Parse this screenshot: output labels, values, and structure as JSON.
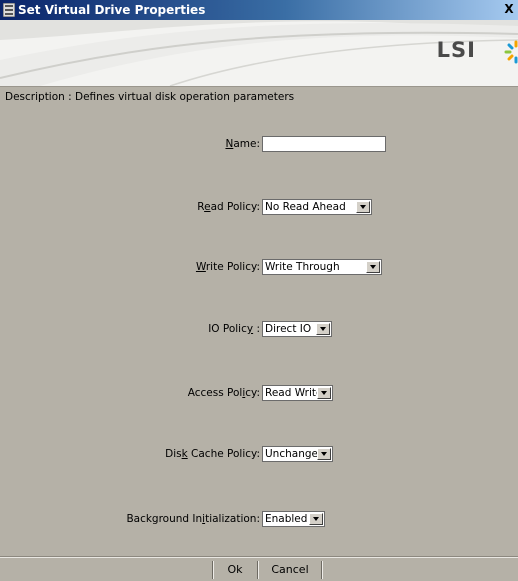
{
  "window": {
    "title": "Set Virtual Drive Properties",
    "close_glyph": "X"
  },
  "banner": {
    "logo_text": "LSI",
    "logo_icon": "lsi-starburst-icon"
  },
  "description": "Description : Defines virtual disk operation parameters",
  "form": {
    "name": {
      "label_pre": "",
      "label_ul": "N",
      "label_post": "ame:",
      "value": ""
    },
    "read_policy": {
      "label_pre": "R",
      "label_ul": "e",
      "label_post": "ad Policy:",
      "value": "No Read Ahead"
    },
    "write_policy": {
      "label_pre": "",
      "label_ul": "W",
      "label_post": "rite Policy:",
      "value": "Write Through"
    },
    "io_policy": {
      "label_pre": "IO Polic",
      "label_ul": "y",
      "label_post": " :",
      "value": "Direct IO"
    },
    "access_policy": {
      "label_pre": "Access Pol",
      "label_ul": "i",
      "label_post": "cy:",
      "value": "Read Write"
    },
    "disk_cache_policy": {
      "label_pre": "Dis",
      "label_ul": "k",
      "label_post": " Cache Policy:",
      "value": "Unchanged"
    },
    "background_init": {
      "label_pre": "Background In",
      "label_ul": "i",
      "label_post": "tialization:",
      "value": "Enabled"
    }
  },
  "buttons": {
    "ok": "Ok",
    "cancel": "Cancel"
  },
  "colors": {
    "titlebar_start": "#0a246a",
    "titlebar_end": "#a6caf0",
    "dialog_bg": "#b5b1a7"
  }
}
